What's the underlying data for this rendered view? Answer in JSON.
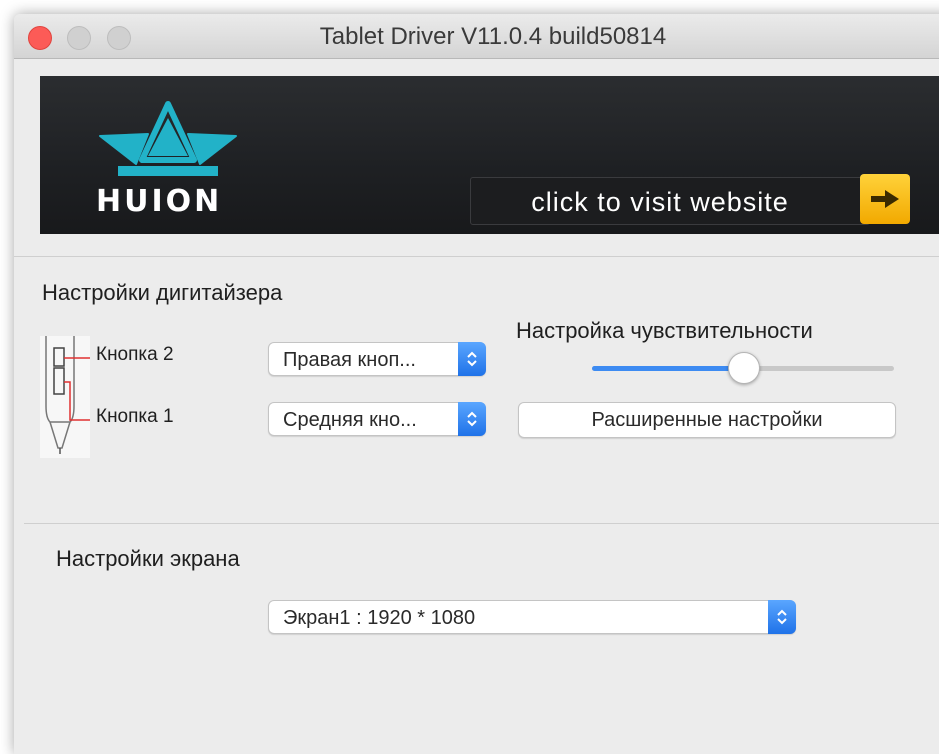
{
  "window": {
    "title": "Tablet Driver V11.0.4 build50814"
  },
  "banner": {
    "brand": "HUION",
    "visit_label": "click to visit website",
    "arrow_icon": "arrow-right-icon",
    "accent_color": "#f7b500",
    "logo_color": "#22b2c8"
  },
  "digitizer": {
    "section_label": "Настройки дигитайзера",
    "button2_label": "Кнопка 2",
    "button1_label": "Кнопка 1",
    "button2_value": "Правая кноп...",
    "button1_value": "Средняя кно...",
    "sensitivity_label": "Настройка чувствительности",
    "sensitivity_level": 0.5,
    "advanced_button": "Расширенные настройки"
  },
  "screen": {
    "section_label": "Настройки экрана",
    "display_value": "Экран1 : 1920 * 1080"
  }
}
